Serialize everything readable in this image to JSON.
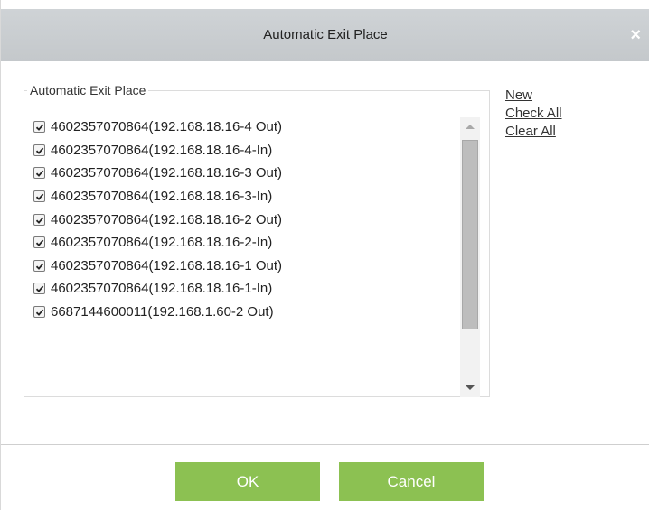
{
  "dialog": {
    "title": "Automatic Exit Place",
    "close_glyph": "×"
  },
  "group": {
    "label": "Automatic Exit Place",
    "items": [
      {
        "label": "4602357070864(192.168.18.16-4 Out)",
        "checked": true
      },
      {
        "label": "4602357070864(192.168.18.16-4-In)",
        "checked": true
      },
      {
        "label": "4602357070864(192.168.18.16-3 Out)",
        "checked": true
      },
      {
        "label": "4602357070864(192.168.18.16-3-In)",
        "checked": true
      },
      {
        "label": "4602357070864(192.168.18.16-2 Out)",
        "checked": true
      },
      {
        "label": "4602357070864(192.168.18.16-2-In)",
        "checked": true
      },
      {
        "label": "4602357070864(192.168.18.16-1 Out)",
        "checked": true
      },
      {
        "label": "4602357070864(192.168.18.16-1-In)",
        "checked": true
      },
      {
        "label": "6687144600011(192.168.1.60-2 Out)",
        "checked": true
      }
    ]
  },
  "links": {
    "new": "New",
    "check_all": "Check All",
    "clear_all": "Clear All"
  },
  "buttons": {
    "ok": "OK",
    "cancel": "Cancel"
  },
  "colors": {
    "accent_green": "#8cc152",
    "titlebar": "#c9cdd0"
  }
}
